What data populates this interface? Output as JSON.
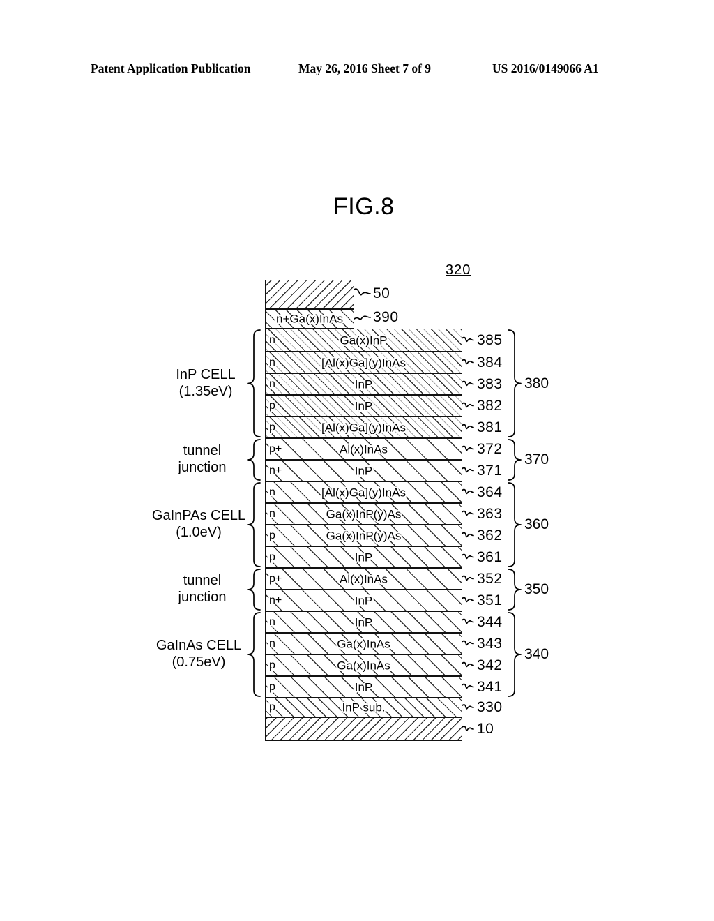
{
  "header": {
    "left": "Patent Application Publication",
    "middle": "May 26, 2016  Sheet 7 of 9",
    "right": "US 2016/0149066 A1"
  },
  "figure": {
    "title": "FIG.8",
    "device_ref": "320"
  },
  "layers": [
    {
      "ref": "50",
      "dopant": "",
      "material": ""
    },
    {
      "ref": "390",
      "dopant": "",
      "material": "n+Ga(x)InAs"
    },
    {
      "ref": "385",
      "dopant": "n",
      "material": "Ga(x)InP"
    },
    {
      "ref": "384",
      "dopant": "n",
      "material": "[Al(x)Ga](y)InAs"
    },
    {
      "ref": "383",
      "dopant": "n",
      "material": "InP"
    },
    {
      "ref": "382",
      "dopant": "p",
      "material": "InP"
    },
    {
      "ref": "381",
      "dopant": "p",
      "material": "[Al(x)Ga](y)InAs"
    },
    {
      "ref": "372",
      "dopant": "p+",
      "material": "Al(x)InAs"
    },
    {
      "ref": "371",
      "dopant": "n+",
      "material": "InP"
    },
    {
      "ref": "364",
      "dopant": "n",
      "material": "[Al(x)Ga](y)InAs"
    },
    {
      "ref": "363",
      "dopant": "n",
      "material": "Ga(x)InP(y)As"
    },
    {
      "ref": "362",
      "dopant": "p",
      "material": "Ga(x)InP(y)As"
    },
    {
      "ref": "361",
      "dopant": "p",
      "material": "InP"
    },
    {
      "ref": "352",
      "dopant": "p+",
      "material": "Al(x)InAs"
    },
    {
      "ref": "351",
      "dopant": "n+",
      "material": "InP"
    },
    {
      "ref": "344",
      "dopant": "n",
      "material": "InP"
    },
    {
      "ref": "343",
      "dopant": "n",
      "material": "Ga(x)InAs"
    },
    {
      "ref": "342",
      "dopant": "p",
      "material": "Ga(x)InAs"
    },
    {
      "ref": "341",
      "dopant": "p",
      "material": "InP"
    },
    {
      "ref": "330",
      "dopant": "p",
      "material": "InP sub."
    },
    {
      "ref": "10",
      "dopant": "",
      "material": ""
    }
  ],
  "groups": [
    {
      "ref": "380"
    },
    {
      "ref": "370"
    },
    {
      "ref": "360"
    },
    {
      "ref": "350"
    },
    {
      "ref": "340"
    }
  ],
  "cell_labels": [
    {
      "line1": "InP CELL",
      "line2": "(1.35eV)"
    },
    {
      "line1": "tunnel",
      "line2": "junction"
    },
    {
      "line1": "GaInPAs CELL",
      "line2": "(1.0eV)"
    },
    {
      "line1": "tunnel",
      "line2": "junction"
    },
    {
      "line1": "GaInAs CELL",
      "line2": "(0.75eV)"
    }
  ],
  "colors": {
    "ink": "#000000",
    "paper": "#ffffff",
    "hatch": "#2f2f2f"
  }
}
